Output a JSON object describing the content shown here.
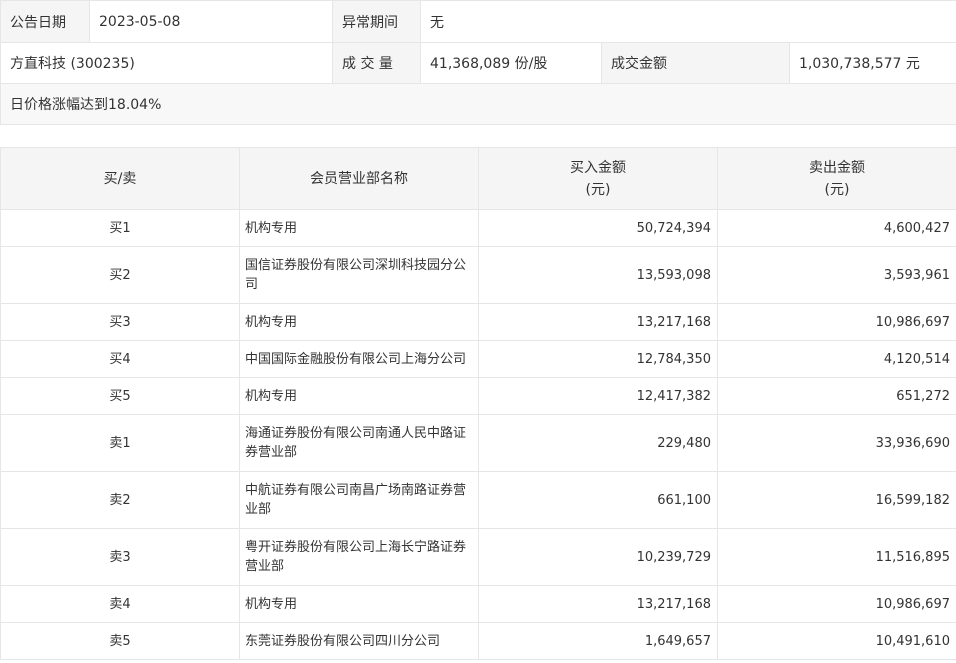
{
  "info": {
    "date_label": "公告日期",
    "date_value": "2023-05-08",
    "period_label": "异常期间",
    "period_value": "无",
    "stock_name": "方直科技 (300235)",
    "volume_label": "成 交 量",
    "volume_value": "41,368,089 份/股",
    "amount_label": "成交金额",
    "amount_value": "1,030,738,577 元",
    "reason": "日价格涨幅达到18.04%"
  },
  "detail": {
    "headers": {
      "side": "买/卖",
      "member": "会员营业部名称",
      "buy": "买入金额",
      "sell": "卖出金额",
      "unit": "(元)"
    },
    "rows": [
      {
        "side": "买1",
        "name": "机构专用",
        "buy": "50,724,394",
        "sell": "4,600,427"
      },
      {
        "side": "买2",
        "name": "国信证券股份有限公司深圳科技园分公司",
        "buy": "13,593,098",
        "sell": "3,593,961"
      },
      {
        "side": "买3",
        "name": "机构专用",
        "buy": "13,217,168",
        "sell": "10,986,697"
      },
      {
        "side": "买4",
        "name": "中国国际金融股份有限公司上海分公司",
        "buy": "12,784,350",
        "sell": "4,120,514"
      },
      {
        "side": "买5",
        "name": "机构专用",
        "buy": "12,417,382",
        "sell": "651,272"
      },
      {
        "side": "卖1",
        "name": "海通证券股份有限公司南通人民中路证券营业部",
        "buy": "229,480",
        "sell": "33,936,690"
      },
      {
        "side": "卖2",
        "name": "中航证券有限公司南昌广场南路证券营业部",
        "buy": "661,100",
        "sell": "16,599,182"
      },
      {
        "side": "卖3",
        "name": "粤开证券股份有限公司上海长宁路证券营业部",
        "buy": "10,239,729",
        "sell": "11,516,895"
      },
      {
        "side": "卖4",
        "name": "机构专用",
        "buy": "13,217,168",
        "sell": "10,986,697"
      },
      {
        "side": "卖5",
        "name": "东莞证券股份有限公司四川分公司",
        "buy": "1,649,657",
        "sell": "10,491,610"
      }
    ]
  }
}
